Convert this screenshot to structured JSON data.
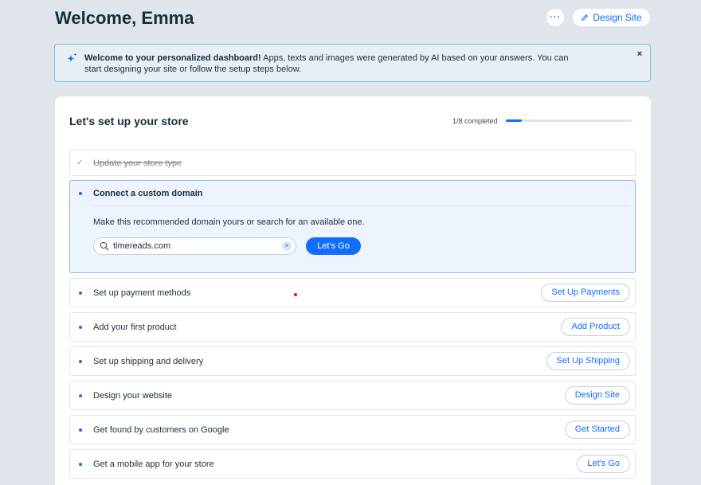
{
  "header": {
    "title": "Welcome, Emma",
    "more_label": "···",
    "design_site_label": "Design Site"
  },
  "banner": {
    "bold_text": "Welcome to your personalized dashboard!",
    "text": " Apps, texts and images were generated by AI based on your answers. You can start designing your site or follow the setup steps below.",
    "close_label": "×"
  },
  "setup": {
    "title": "Let's set up your store",
    "progress_label": "1/8 completed",
    "progress_fraction": 0.125,
    "completed_step": "Update your store type",
    "domain_step": {
      "title": "Connect a custom domain",
      "description": "Make this recommended domain yours or search for an available one.",
      "input_value": "timereads.com",
      "clear_label": "×",
      "button_label": "Let's Go"
    },
    "steps": [
      {
        "label": "Set up payment methods",
        "button": "Set Up Payments"
      },
      {
        "label": "Add your first product",
        "button": "Add Product"
      },
      {
        "label": "Set up shipping and delivery",
        "button": "Set Up Shipping"
      },
      {
        "label": "Design your website",
        "button": "Design Site"
      },
      {
        "label": "Get found by customers on Google",
        "button": "Get Started"
      },
      {
        "label": "Get a mobile app for your store",
        "button": "Let's Go"
      }
    ]
  },
  "colors": {
    "accent": "#116dff",
    "background": "#dfe5eb",
    "check": "#60bc57"
  }
}
